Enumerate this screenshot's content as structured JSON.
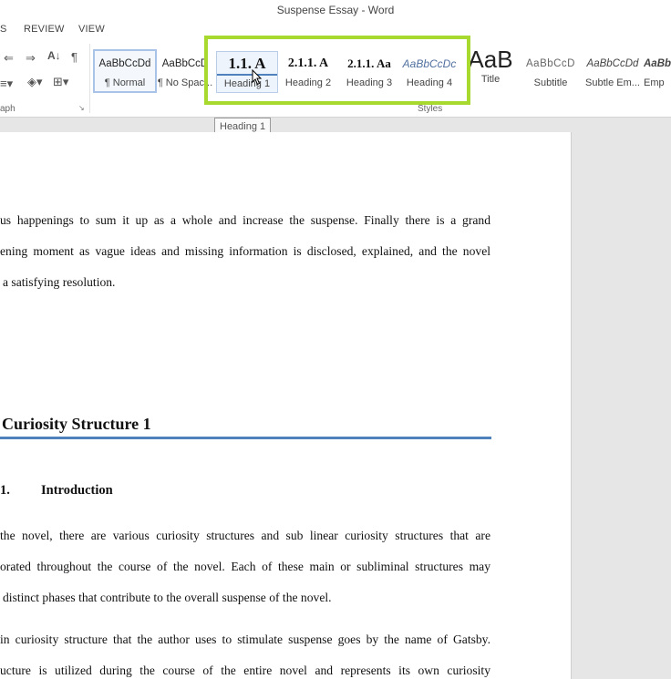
{
  "window": {
    "title": "Suspense Essay - Word"
  },
  "tabs": [
    "S",
    "REVIEW",
    "VIEW"
  ],
  "ribbon": {
    "paragraph_group_label": "aph",
    "styles_group_label": "Styles",
    "icons": [
      "decrease-indent-icon",
      "increase-indent-icon",
      "sort-icon",
      "show-formatting-icon",
      "line-spacing-icon",
      "shading-icon",
      "borders-icon"
    ],
    "styles": [
      {
        "sample": "AaBbCcDd",
        "name": "¶ Normal"
      },
      {
        "sample": "AaBbCcD",
        "name": "¶ No Spac..."
      },
      {
        "sample": "1.1.  A",
        "name": "Heading 1"
      },
      {
        "sample": "2.1.1.  A",
        "name": "Heading 2"
      },
      {
        "sample": "2.1.1.  Aa",
        "name": "Heading 3"
      },
      {
        "sample": "AaBbCcDc",
        "name": "Heading 4"
      },
      {
        "sample": "AaB",
        "name": "Title"
      },
      {
        "sample": "AaBbCcD",
        "name": "Subtitle"
      },
      {
        "sample": "AaBbCcDd",
        "name": "Subtle Em..."
      },
      {
        "sample": "AaBb",
        "name": "Emp"
      }
    ]
  },
  "tooltip": "Heading 1",
  "document": {
    "para1": [
      "us happenings to sum it up as a whole and increase the suspense. Finally there is a grand",
      "ening moment as vague ideas and missing information is disclosed, explained, and the novel",
      "a satisfying resolution."
    ],
    "heading1": "Curiosity Structure 1",
    "heading2_number": "1.",
    "heading2_text": "Introduction",
    "para2": [
      "the novel, there are various curiosity structures and sub linear curiosity structures that are",
      "orated throughout the course of the novel. Each of these main or subliminal structures may",
      "distinct phases that contribute to the overall suspense of the novel."
    ],
    "para3": [
      "in curiosity structure that the author uses to stimulate suspense goes by the name of Gatsby.",
      "ucture is utilized during the course of the entire novel and represents its own curiosity"
    ]
  },
  "colors": {
    "highlight": "#a7d92f",
    "heading_rule": "#4f81bd"
  }
}
